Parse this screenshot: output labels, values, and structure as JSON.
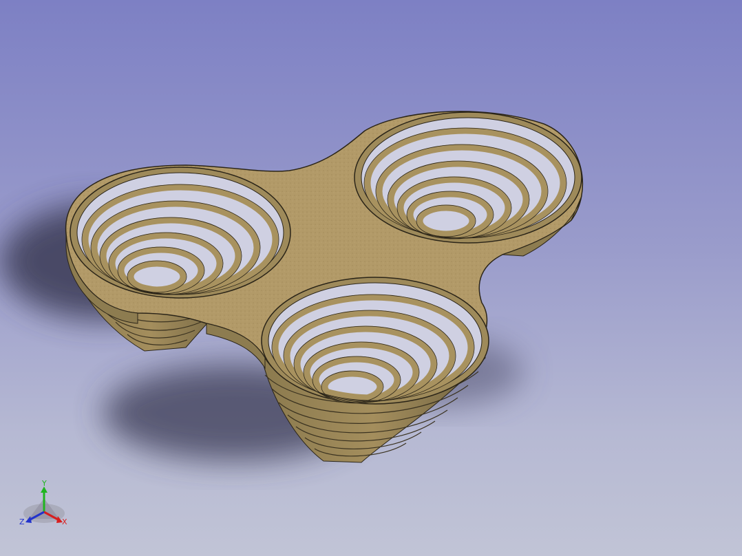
{
  "viewport": {
    "background_top": "#7d80c4",
    "background_bottom": "#c1c4d6"
  },
  "model": {
    "material_color": "#b29a68",
    "edge_color": "#2a2418"
  },
  "triad": {
    "x_label": "X",
    "y_label": "Y",
    "z_label": "Z",
    "x_color": "#d81e1e",
    "y_color": "#1fb51f",
    "z_color": "#2233cc"
  }
}
